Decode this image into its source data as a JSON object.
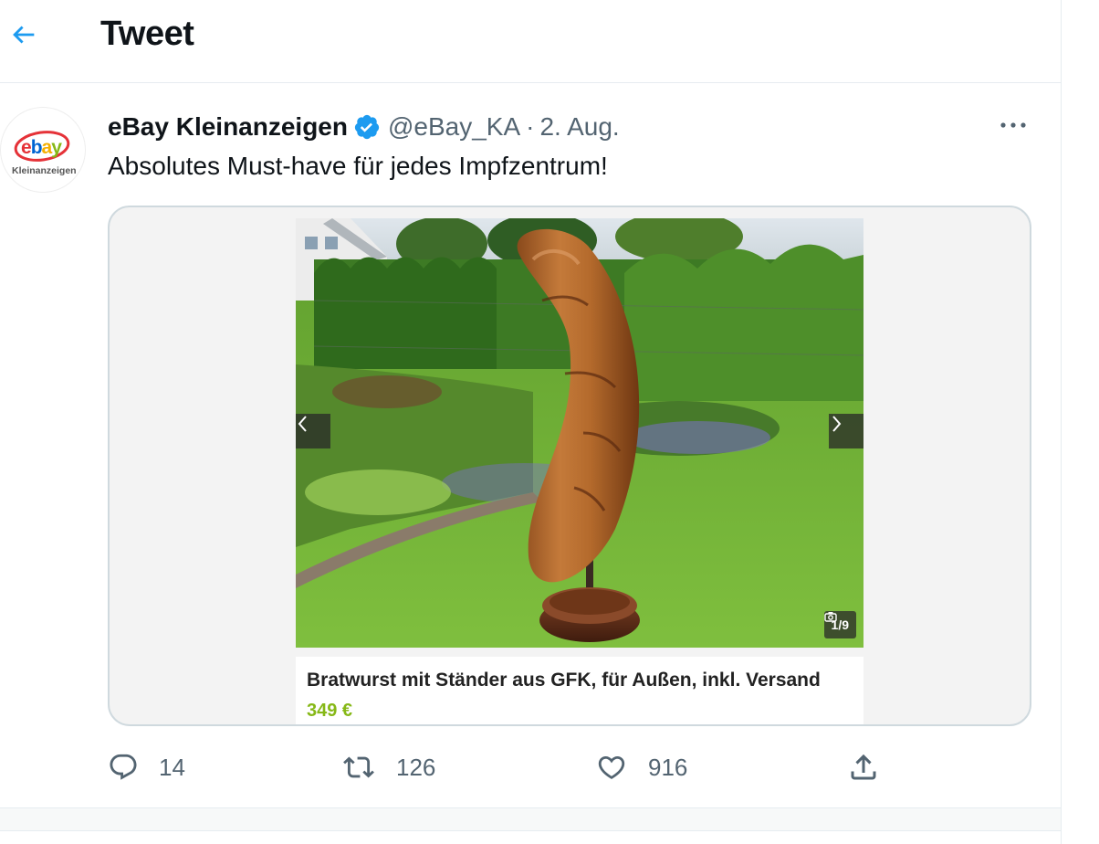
{
  "header": {
    "title": "Tweet",
    "back_icon": "arrow-left-icon"
  },
  "tweet": {
    "avatar_logo": {
      "brand": "ebay",
      "subtitle": "Kleinanzeigen"
    },
    "display_name": "eBay Kleinanzeigen",
    "verified": true,
    "handle": "@eBay_KA",
    "separator": "·",
    "date": "2. Aug.",
    "text": "Absolutes Must-have für jedes Impfzentrum!",
    "more_icon": "more-dots-icon"
  },
  "media": {
    "counter": "1/9",
    "listing_title": "Bratwurst mit Ständer aus GFK, für Außen, inkl. Versand",
    "listing_price": "349 €"
  },
  "actions": {
    "replies": "14",
    "retweets": "126",
    "likes": "916"
  },
  "colors": {
    "accent": "#1d9bf0",
    "muted": "#536471",
    "price_green": "#86b817",
    "border": "#cfd9de"
  }
}
